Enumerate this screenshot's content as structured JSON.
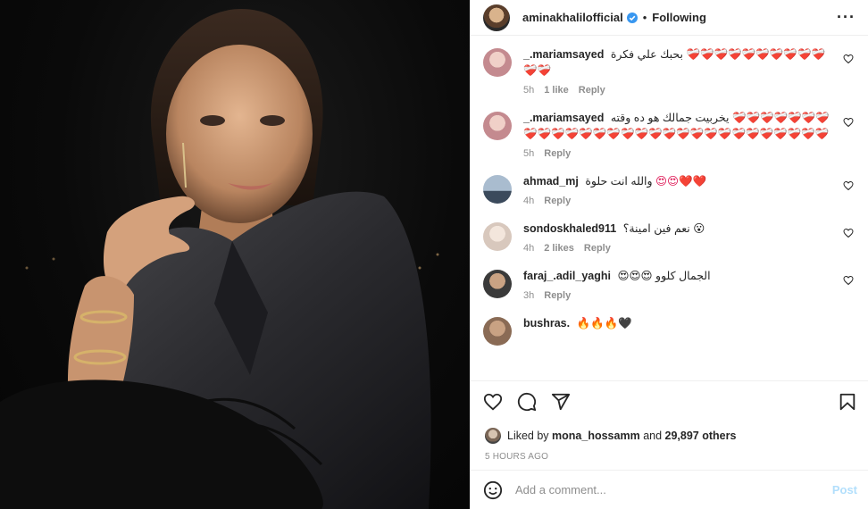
{
  "header": {
    "username": "aminakhalilofficial",
    "separator": "•",
    "follow_status": "Following",
    "more_icon": "more-horizontal-icon"
  },
  "comments": [
    {
      "username": "_.mariamsayed",
      "text": "بحبك علي فكرة",
      "emojis": "❤️‍🩹❤️‍🩹❤️‍🩹❤️‍🩹❤️‍🩹❤️‍🩹❤️‍🩹❤️‍🩹❤️‍🩹❤️‍🩹❤️‍🩹❤️‍🩹",
      "time": "5h",
      "likes": "1 like",
      "reply": "Reply",
      "avatar_color": "#c48a8f"
    },
    {
      "username": "_.mariamsayed",
      "text": "يخربيت جمالك هو ده وقته",
      "emojis": "❤️‍🩹❤️‍🩹❤️‍🩹❤️‍🩹❤️‍🩹❤️‍🩹❤️‍🩹❤️‍🩹❤️‍🩹❤️‍🩹❤️‍🩹❤️‍🩹❤️‍🩹❤️‍🩹❤️‍🩹❤️‍🩹❤️‍🩹❤️‍🩹❤️‍🩹❤️‍🩹❤️‍🩹❤️‍🩹❤️‍🩹❤️‍🩹❤️‍🩹❤️‍🩹❤️‍🩹❤️‍🩹❤️‍🩹",
      "time": "5h",
      "likes": "",
      "reply": "Reply",
      "avatar_color": "#c48a8f"
    },
    {
      "username": "ahmad_mj",
      "text": "والله انت حلوة",
      "emojis": "😍😍❤️❤️",
      "time": "4h",
      "likes": "",
      "reply": "Reply",
      "avatar_color": "#7d8ea3"
    },
    {
      "username": "sondoskhaled911",
      "text": "نعم فين امينة؟",
      "emojis": "😮",
      "time": "4h",
      "likes": "2 likes",
      "reply": "Reply",
      "avatar_color": "#d8c8bd"
    },
    {
      "username": "faraj_.adil_yaghi",
      "text": "الجمال كلوو",
      "emojis": "😍😍😍",
      "time": "3h",
      "likes": "",
      "reply": "Reply",
      "avatar_color": "#6b5a4e"
    },
    {
      "username": "bushras.",
      "text": "",
      "emojis": "🔥🔥🔥🖤",
      "time": "",
      "likes": "",
      "reply": "",
      "avatar_color": "#8a6b55"
    }
  ],
  "actions": {
    "like_icon": "heart-icon",
    "comment_icon": "comment-icon",
    "share_icon": "share-icon",
    "save_icon": "bookmark-icon"
  },
  "likes": {
    "prefix": "Liked by",
    "user": "mona_hossamm",
    "and": "and",
    "others": "29,897 others"
  },
  "posted_ago": "5 HOURS AGO",
  "add_comment": {
    "placeholder": "Add a comment...",
    "post_label": "Post",
    "emoji_icon": "smiley-icon"
  },
  "colors": {
    "accent_blue": "#0095f6",
    "post_disabled": "#b2dffc",
    "meta_grey": "#8e8e8e",
    "heart_red": "#e0245e"
  }
}
